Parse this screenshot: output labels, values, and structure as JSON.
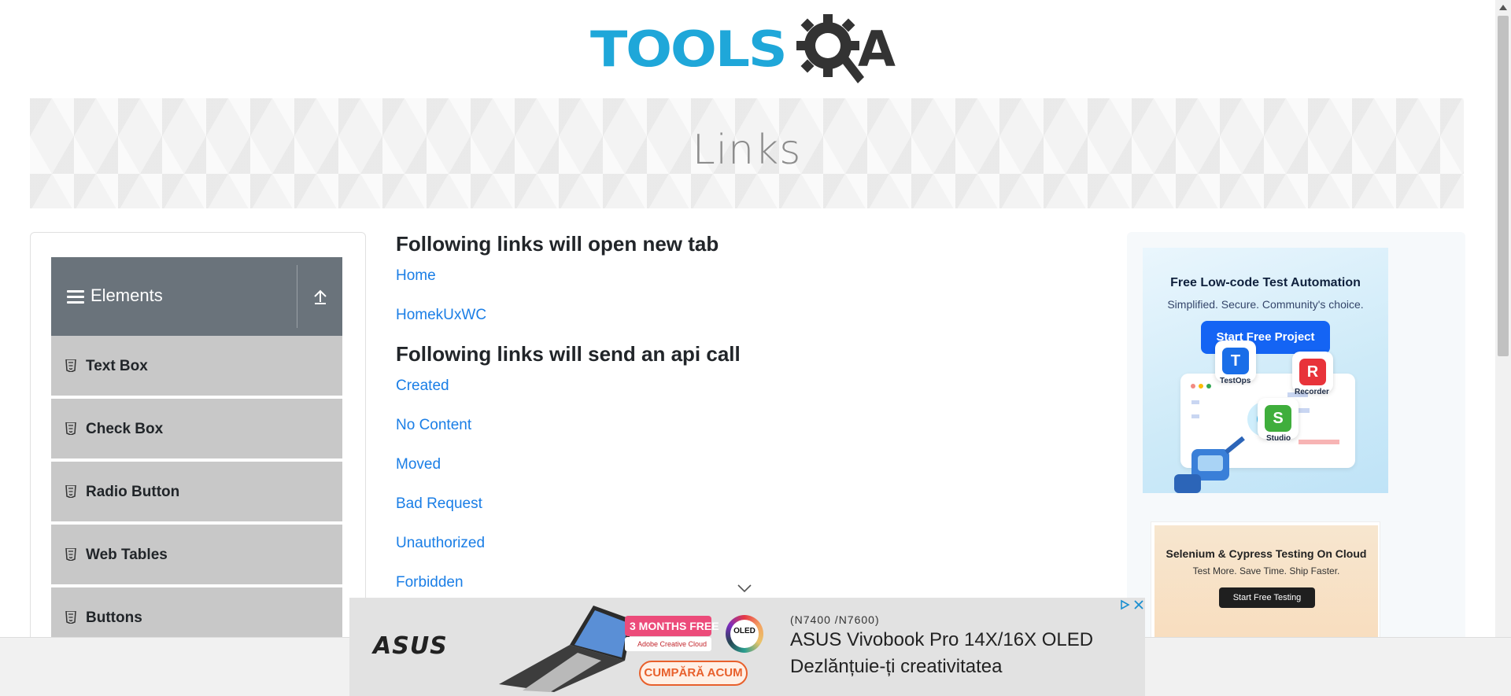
{
  "logo": {
    "text_tools": "TOOLS",
    "text_a": "A"
  },
  "banner": {
    "title": "Links"
  },
  "sidebar": {
    "group_title": "Elements",
    "items": [
      {
        "label": "Text Box"
      },
      {
        "label": "Check Box"
      },
      {
        "label": "Radio Button"
      },
      {
        "label": "Web Tables"
      },
      {
        "label": "Buttons"
      }
    ]
  },
  "main": {
    "section1_title": "Following links will open new tab",
    "new_tab_links": [
      "Home",
      "HomekUxWC"
    ],
    "section2_title": "Following links will send an api call",
    "api_links": [
      "Created",
      "No Content",
      "Moved",
      "Bad Request",
      "Unauthorized",
      "Forbidden"
    ]
  },
  "ads": {
    "ad1": {
      "title": "Free Low-code Test Automation",
      "subtitle": "Simplified. Secure. Community's choice.",
      "button": "Start Free Project",
      "apps": [
        {
          "letter": "T",
          "label": "TestOps",
          "color": "#1a6ee8"
        },
        {
          "letter": "R",
          "label": "Recorder",
          "color": "#e8333a"
        },
        {
          "letter": "S",
          "label": "Studio",
          "color": "#3fae3c"
        }
      ]
    },
    "ad2": {
      "title": "Selenium & Cypress Testing On Cloud",
      "subtitle": "Test More. Save Time. Ship Faster.",
      "button": "Start Free Testing"
    },
    "bottom": {
      "brand": "ASUS",
      "promo": "3 MONTHS FREE",
      "promo_sub": "Adobe Creative Cloud",
      "oled": "OLED",
      "buy": "CUMPĂRĂ ACUM",
      "model": "(N7400 /N7600)",
      "headline": "ASUS Vivobook Pro 14X/16X OLED",
      "tagline": "Dezlănțuie-ți creativitatea"
    }
  },
  "colors": {
    "link": "#1a7ee6",
    "sidebar_header": "#6a737b",
    "sidebar_item": "#c8c8c8",
    "logo_blue": "#1fa7d9"
  }
}
